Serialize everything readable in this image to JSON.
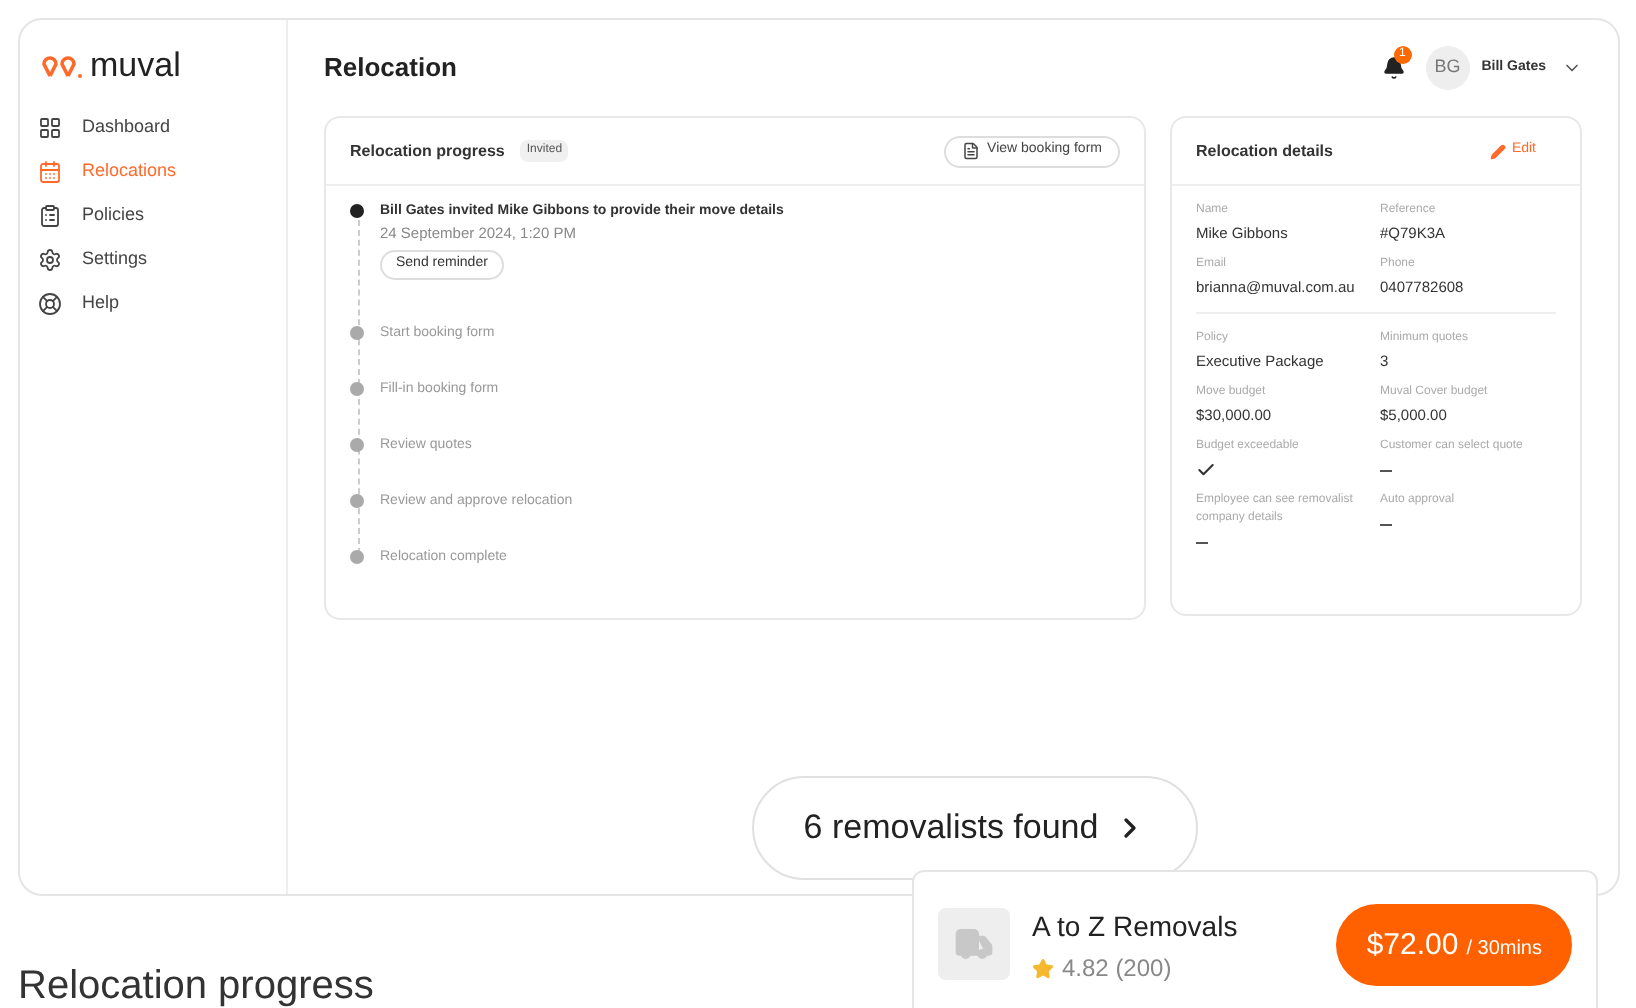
{
  "brand": {
    "name": "muval"
  },
  "sidebar": {
    "items": [
      {
        "label": "Dashboard",
        "selected": false
      },
      {
        "label": "Relocations",
        "selected": true
      },
      {
        "label": "Policies",
        "selected": false
      },
      {
        "label": "Settings",
        "selected": false
      },
      {
        "label": "Help",
        "selected": false
      }
    ]
  },
  "header": {
    "title": "Relocation",
    "notifications": "1",
    "user": {
      "initials": "BG",
      "name": "Bill Gates"
    }
  },
  "progress": {
    "title": "Relocation progress",
    "badge": "Invited",
    "action": "View booking form",
    "steps": [
      {
        "label": "Bill Gates invited Mike Gibbons to provide their move details",
        "date": "24 September 2024, 1:20 PM",
        "button": "Send reminder",
        "done": true
      },
      {
        "label": "Start booking form",
        "done": false
      },
      {
        "label": "Fill-in booking form",
        "done": false
      },
      {
        "label": "Review quotes",
        "done": false
      },
      {
        "label": "Review and approve relocation",
        "done": false
      },
      {
        "label": "Relocation complete",
        "done": false
      }
    ]
  },
  "details": {
    "title": "Relocation details",
    "action": "Edit",
    "sections": [
      [
        {
          "label": "Name",
          "kind": "text",
          "value": "Mike Gibbons"
        },
        {
          "label": "Reference",
          "kind": "text",
          "value": "#Q79K3A"
        },
        {
          "label": "Email",
          "kind": "text",
          "value": "brianna@muval.com.au"
        },
        {
          "label": "Phone",
          "kind": "text",
          "value": "0407782608"
        }
      ],
      [
        {
          "label": "Policy",
          "kind": "text",
          "value": "Executive Package"
        },
        {
          "label": "Minimum quotes",
          "kind": "text",
          "value": "3"
        },
        {
          "label": "Move budget",
          "kind": "text",
          "value": "$30,000.00"
        },
        {
          "label": "Muval Cover budget",
          "kind": "text",
          "value": "$5,000.00"
        },
        {
          "label": "Budget exceedable",
          "kind": "flag",
          "checked": true
        },
        {
          "label": "Customer can select quote",
          "kind": "flag",
          "checked": false
        },
        {
          "label": "Employee can see removalist company details",
          "kind": "flag",
          "checked": false
        },
        {
          "label": "Auto approval",
          "kind": "flag",
          "checked": false
        }
      ]
    ]
  },
  "found_button": {
    "label": "6 removalists found"
  },
  "removalist": {
    "name": "A to Z Removals",
    "stars": 1,
    "rating": "4.82 (200)",
    "price": "$72.00",
    "unit": "/ 30mins"
  },
  "below_heading": "Relocation progress"
}
